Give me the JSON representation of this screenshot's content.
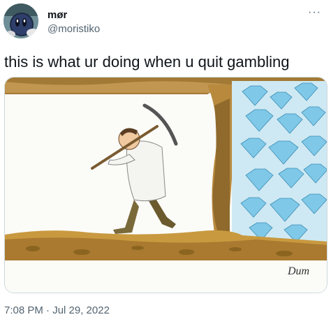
{
  "tweet": {
    "author": {
      "display_name": "mør",
      "handle": "@moristiko",
      "avatar_icon": "avatar-kirby-icon"
    },
    "more_label": "···",
    "text": "this is what ur doing when u quit gambling",
    "image": {
      "signature": "Dum",
      "icons": [
        "pickaxe-icon",
        "diamond-icon"
      ]
    },
    "timestamp": "7:08 PM · Jul 29, 2022"
  },
  "colors": {
    "text_primary": "#0f1419",
    "text_secondary": "#536471",
    "border": "#cfd9de",
    "soil": "#b38a3d",
    "diamond": "#7fc8e8"
  }
}
